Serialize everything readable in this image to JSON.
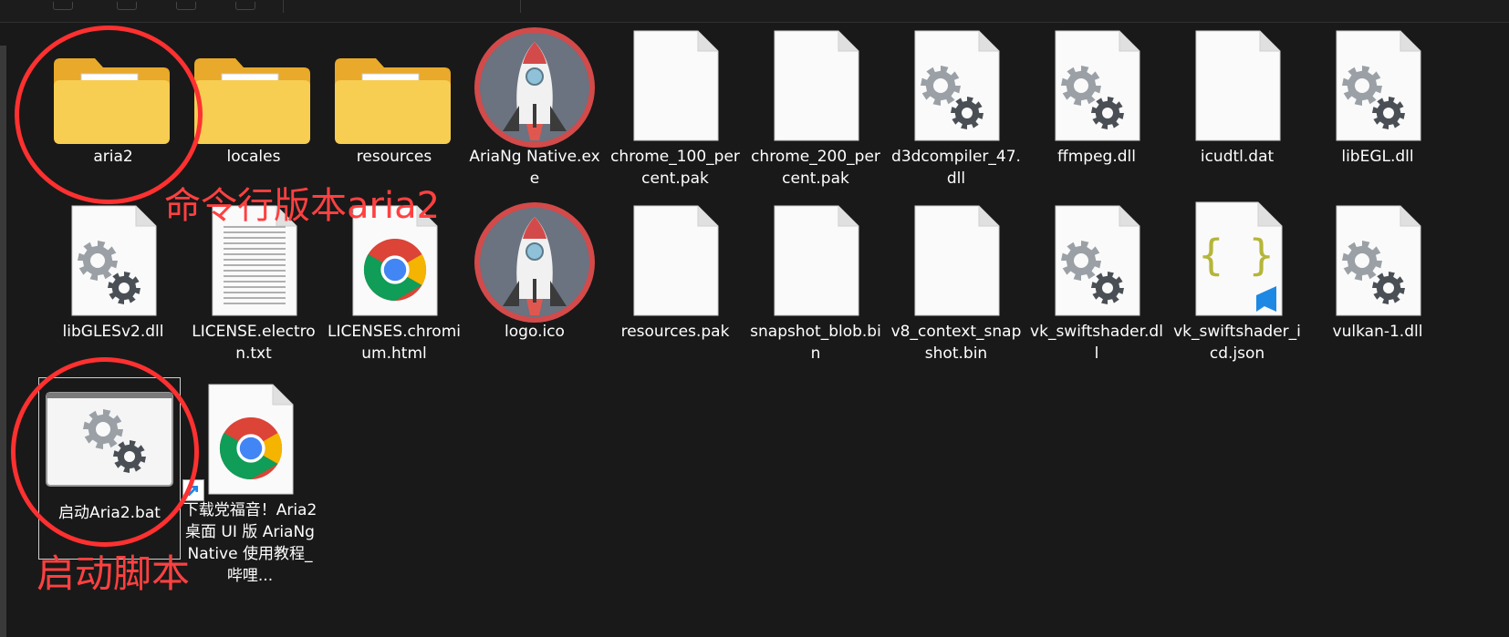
{
  "files": [
    {
      "name": "aria2",
      "kind": "folder",
      "icon": "folder-icon"
    },
    {
      "name": "locales",
      "kind": "folder",
      "icon": "folder-icon"
    },
    {
      "name": "resources",
      "kind": "folder",
      "icon": "folder-icon"
    },
    {
      "name": "AriaNg Native.exe",
      "kind": "app",
      "icon": "rocket-icon"
    },
    {
      "name": "chrome_100_percent.pak",
      "kind": "file",
      "icon": "blank-file-icon"
    },
    {
      "name": "chrome_200_percent.pak",
      "kind": "file",
      "icon": "blank-file-icon"
    },
    {
      "name": "d3dcompiler_47.dll",
      "kind": "dll",
      "icon": "gear-file-icon"
    },
    {
      "name": "ffmpeg.dll",
      "kind": "dll",
      "icon": "gear-file-icon"
    },
    {
      "name": "icudtl.dat",
      "kind": "file",
      "icon": "blank-file-icon"
    },
    {
      "name": "libEGL.dll",
      "kind": "dll",
      "icon": "gear-file-icon"
    },
    {
      "name": "libGLESv2.dll",
      "kind": "dll",
      "icon": "gear-file-icon"
    },
    {
      "name": "LICENSE.electron.txt",
      "kind": "text",
      "icon": "text-file-icon"
    },
    {
      "name": "LICENSES.chromium.html",
      "kind": "html",
      "icon": "chrome-icon"
    },
    {
      "name": "logo.ico",
      "kind": "ico",
      "icon": "rocket-icon"
    },
    {
      "name": "resources.pak",
      "kind": "file",
      "icon": "blank-file-icon"
    },
    {
      "name": "snapshot_blob.bin",
      "kind": "file",
      "icon": "blank-file-icon"
    },
    {
      "name": "v8_context_snapshot.bin",
      "kind": "file",
      "icon": "blank-file-icon"
    },
    {
      "name": "vk_swiftshader.dll",
      "kind": "dll",
      "icon": "gear-file-icon"
    },
    {
      "name": "vk_swiftshader_icd.json",
      "kind": "json",
      "icon": "json-file-icon"
    },
    {
      "name": "vulkan-1.dll",
      "kind": "dll",
      "icon": "gear-file-icon"
    },
    {
      "name": "启动Aria2.bat",
      "kind": "bat",
      "icon": "batch-file-icon",
      "selected": true
    },
    {
      "name": "下载党福音！Aria2 桌面 UI 版 AriaNg Native 使用教程_哔哩...",
      "kind": "url",
      "icon": "chrome-shortcut-icon"
    }
  ],
  "annotations": {
    "cli": "命令行版本aria2",
    "script": "启动脚本"
  },
  "colors": {
    "background": "#191919",
    "annotation": "#ff3030",
    "folder": "#f5c542"
  }
}
